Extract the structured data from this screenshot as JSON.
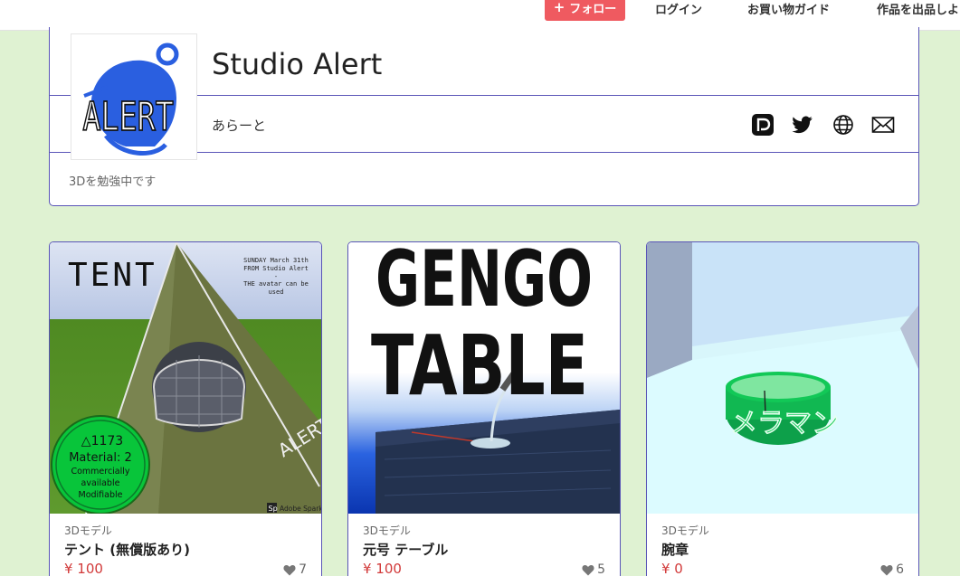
{
  "header": {
    "follow_label": "フォロー",
    "follow_plus": "+",
    "nav": [
      {
        "label": "ログイン"
      },
      {
        "label": "お買い物ガイド"
      },
      {
        "label": "作品を出品しよ"
      }
    ]
  },
  "profile": {
    "logo_text": "ALERT",
    "name": "Studio Alert",
    "handle": "あらーと",
    "bio": "3Dを勉強中です",
    "social_icons": [
      "pixiv-icon",
      "twitter-icon",
      "globe-icon",
      "mail-icon"
    ]
  },
  "products": [
    {
      "category": "3Dモデル",
      "title": "テント (無償版あり)",
      "price": "¥ 100",
      "likes": "7",
      "thumb": {
        "heading": "TENT",
        "note_lines": [
          "SUNDAY March 31th",
          "FROM Studio Alert",
          "-",
          "THE avatar can be",
          "used"
        ],
        "badge_lines": [
          "△1173",
          "Material: 2",
          "Commercially",
          "available",
          "Modifiable"
        ],
        "side_text": "ALERT",
        "watermark": "Adobe Spark",
        "watermark_logo": "Sp"
      }
    },
    {
      "category": "3Dモデル",
      "title": "元号 テーブル",
      "price": "¥ 100",
      "likes": "5",
      "thumb": {
        "line1": "GENGO",
        "line2": "TABLE"
      }
    },
    {
      "category": "3Dモデル",
      "title": "腕章",
      "price": "¥ 0",
      "likes": "6",
      "thumb": {
        "band_text": "メラマン"
      }
    }
  ],
  "colors": {
    "page_bg": "#dff2d2",
    "accent": "#5a55b8",
    "follow_btn": "#ef5a60",
    "price": "#d23a3a"
  }
}
